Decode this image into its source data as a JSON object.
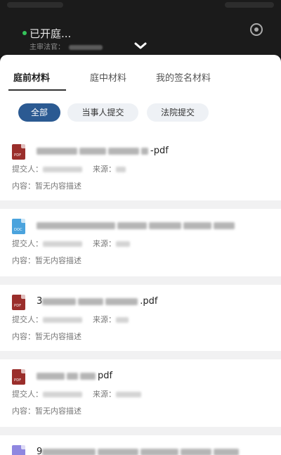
{
  "header": {
    "title": "已开庭...",
    "subtitle": "主审法官："
  },
  "tabs": [
    {
      "label": "庭前材料",
      "active": true
    },
    {
      "label": "庭中材料",
      "active": false
    },
    {
      "label": "我的签名材料",
      "active": false
    }
  ],
  "filters": [
    {
      "label": "全部",
      "active": true
    },
    {
      "label": "当事人提交",
      "active": false
    },
    {
      "label": "法院提交",
      "active": false
    }
  ],
  "labels": {
    "submitter": "提交人：",
    "source": "来源：",
    "content": "内容：",
    "content_value": "暂无内容描述"
  },
  "files": [
    {
      "type": "pdf",
      "icon": "pdf-file-icon",
      "tag": "PDF",
      "name_visible": "-pdf"
    },
    {
      "type": "doc",
      "icon": "doc-file-icon",
      "tag": "DOC",
      "name_visible": ""
    },
    {
      "type": "pdf",
      "icon": "pdf-file-icon",
      "tag": "PDF",
      "name_visible_prefix": "3",
      "name_visible": ".pdf"
    },
    {
      "type": "pdf",
      "icon": "pdf-file-icon",
      "tag": "PDF",
      "name_visible": "pdf"
    },
    {
      "type": "img",
      "icon": "image-file-icon",
      "tag": "",
      "name_visible_prefix": "9",
      "name_visible": ""
    }
  ],
  "colors": {
    "accent": "#2b5a92",
    "pdf": "#9a2e2b",
    "doc": "#4aa3dd",
    "img": "#8f87e0",
    "live": "#35c45b"
  }
}
